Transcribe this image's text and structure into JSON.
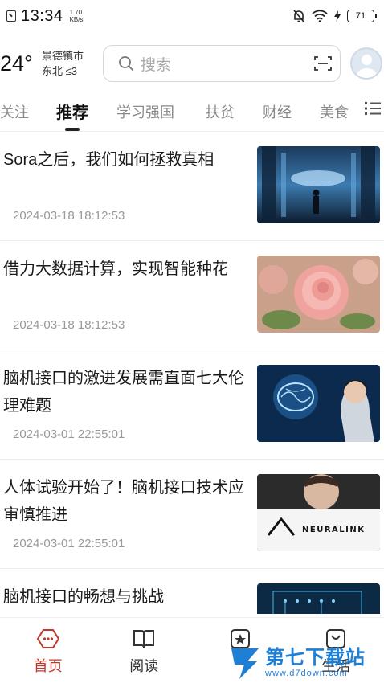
{
  "status_bar": {
    "time": "13:34",
    "speed_value": "1.70",
    "speed_unit": "KB/s",
    "battery": "71"
  },
  "header": {
    "temperature": "24°",
    "city": "景德镇市",
    "wind": "东北 ≤3",
    "search_placeholder": "搜索"
  },
  "tabs": [
    {
      "label": "关注"
    },
    {
      "label": "推荐"
    },
    {
      "label": "学习强国"
    },
    {
      "label": "扶贫"
    },
    {
      "label": "财经"
    },
    {
      "label": "美食"
    }
  ],
  "news": [
    {
      "title": "Sora之后，我们如何拯救真相",
      "time": "2024-03-18 18:12:53",
      "image": "person-in-digital-corridor"
    },
    {
      "title": "借力大数据计算，实现智能种花",
      "time": "2024-03-18 18:12:53",
      "image": "pink-rose"
    },
    {
      "title": "脑机接口的激进发展需直面七大伦理难题",
      "time": "2024-03-01 22:55:01",
      "image": "woman-and-glowing-brain"
    },
    {
      "title": "人体试验开始了！脑机接口技术应审慎推进",
      "time": "2024-03-01 22:55:01",
      "image": "neuralink-logo"
    },
    {
      "title": "脑机接口的畅想与挑战",
      "time": "",
      "image": "circuit-board"
    }
  ],
  "neuralink_text": "NEURALINK",
  "bottom_nav": [
    {
      "label": "首页",
      "icon": "home-icon"
    },
    {
      "label": "阅读",
      "icon": "book-icon"
    },
    {
      "label": "",
      "icon": "star-icon"
    },
    {
      "label": "生活",
      "icon": "life-icon"
    }
  ],
  "watermark": {
    "title": "第七下载站",
    "url": "www.d7down.com"
  },
  "colors": {
    "accent": "#c0392b",
    "watermark": "#1e7fd6"
  }
}
